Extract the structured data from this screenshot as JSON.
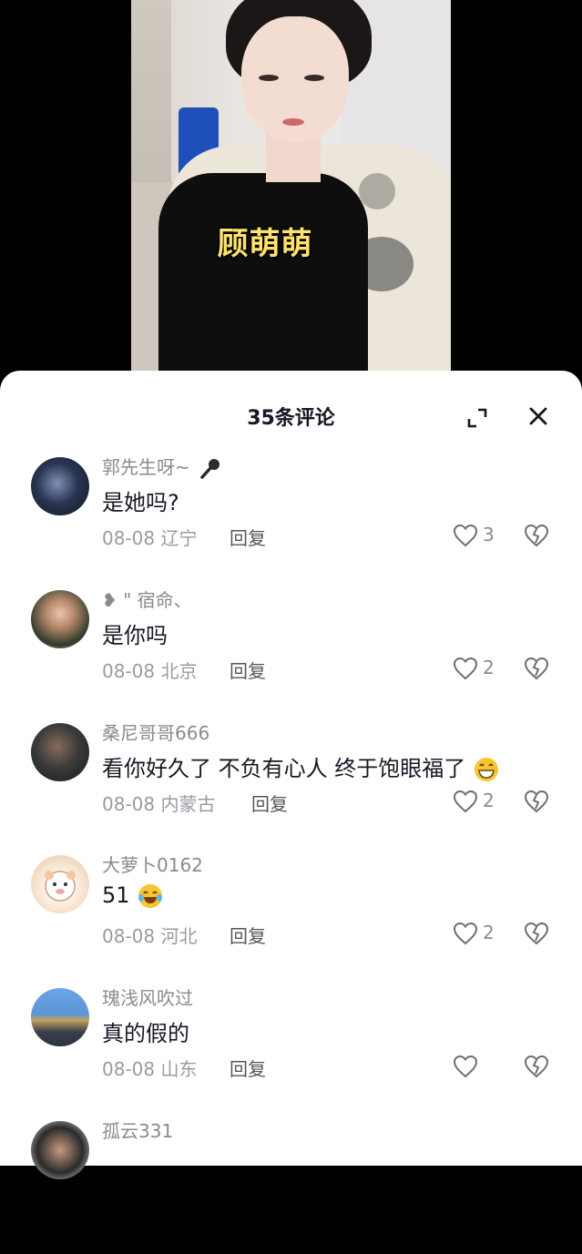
{
  "video": {
    "caption": "顾萌萌"
  },
  "comments_panel": {
    "title": "35条评论",
    "comments": [
      {
        "user": "郭先生呀~",
        "text": "是她吗?",
        "date": "08-08",
        "location": "辽宁",
        "reply_label": "回复",
        "likes": "3",
        "avatar_color": "#1c2a3d"
      },
      {
        "user": "❥ \" 宿命、",
        "text": "是你吗",
        "date": "08-08",
        "location": "北京",
        "reply_label": "回复",
        "likes": "2",
        "avatar_color": "#2e3a2a"
      },
      {
        "user": "桑尼哥哥666",
        "text": "看你好久了 不负有心人 终于饱眼福了",
        "date": "08-08",
        "location": "内蒙古",
        "reply_label": "回复",
        "likes": "2",
        "avatar_color": "#3b3b3b"
      },
      {
        "user": "大萝卜0162",
        "text": "51",
        "date": "08-08",
        "location": "河北",
        "reply_label": "回复",
        "likes": "2",
        "avatar_color": "#f4e8d8"
      },
      {
        "user": "瑰浅风吹过",
        "text": "真的假的",
        "date": "08-08",
        "location": "山东",
        "reply_label": "回复",
        "likes": "",
        "avatar_color": "#3c6fa6"
      },
      {
        "user": "孤云331",
        "text": "",
        "date": "",
        "location": "",
        "reply_label": "",
        "likes": "",
        "avatar_color": "#2b2b2b"
      }
    ]
  }
}
